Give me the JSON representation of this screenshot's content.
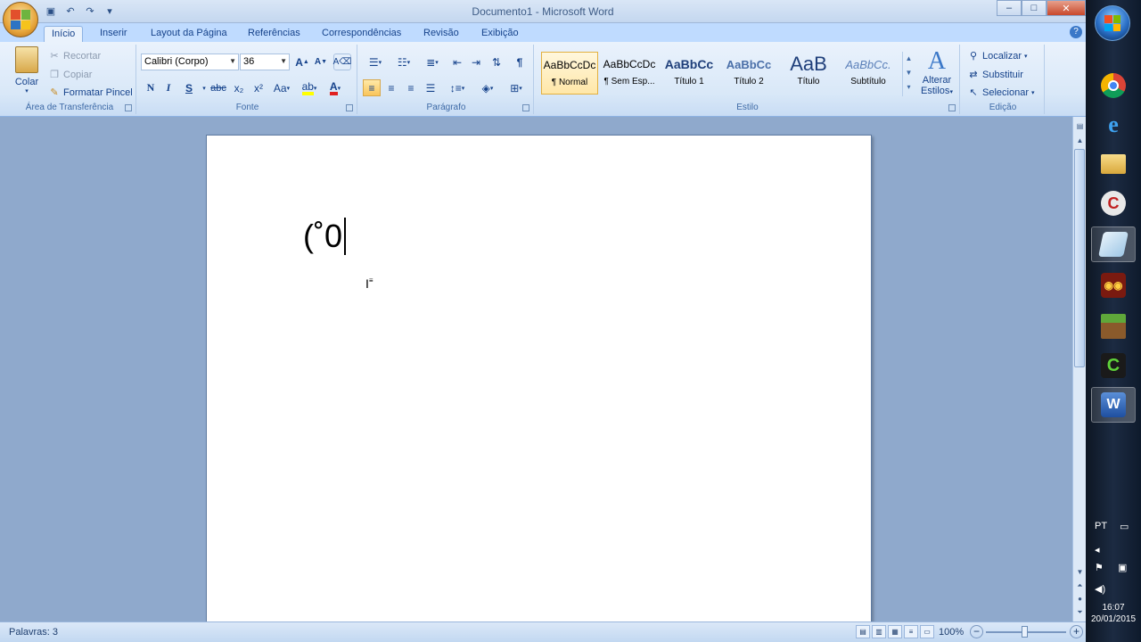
{
  "window": {
    "title": "Documento1 - Microsoft Word",
    "controls": {
      "minimize": "–",
      "maximize": "□",
      "close": "✕"
    }
  },
  "tabs": [
    "Início",
    "Inserir",
    "Layout da Página",
    "Referências",
    "Correspondências",
    "Revisão",
    "Exibição"
  ],
  "active_tab": "Início",
  "ribbon": {
    "clipboard": {
      "label": "Área de Transferência",
      "paste": "Colar",
      "cut": "Recortar",
      "copy": "Copiar",
      "format_painter": "Formatar Pincel"
    },
    "font": {
      "label": "Fonte",
      "font_name": "Calibri (Corpo)",
      "font_size": "36",
      "bold": "N",
      "italic": "I",
      "underline": "S",
      "strikethrough": "abc",
      "subscript": "x₂",
      "superscript": "x²",
      "change_case": "Aa",
      "grow": "A",
      "shrink": "A",
      "font_color_letter": "A"
    },
    "paragraph": {
      "label": "Parágrafo",
      "pilcrow": "¶"
    },
    "styles": {
      "label": "Estilo",
      "items": [
        {
          "preview": "AaBbCcDc",
          "name": "¶ Normal"
        },
        {
          "preview": "AaBbCcDc",
          "name": "¶ Sem Esp..."
        },
        {
          "preview": "AaBbCc",
          "name": "Título 1"
        },
        {
          "preview": "AaBbCc",
          "name": "Título 2"
        },
        {
          "preview": "AaB",
          "name": "Título"
        },
        {
          "preview": "AaBbCc.",
          "name": "Subtítulo"
        }
      ],
      "change_styles_line1": "Alterar",
      "change_styles_line2": "Estilos",
      "change_styles_icon": "A"
    },
    "editing": {
      "label": "Edição",
      "find": "Localizar",
      "replace": "Substituir",
      "select": "Selecionar"
    }
  },
  "document": {
    "text": "(˚0"
  },
  "statusbar": {
    "words": "Palavras: 3",
    "zoom": "100%"
  },
  "taskbar": {
    "language": "PT",
    "time": "16:07",
    "date": "20/01/2015",
    "apps": [
      "chrome",
      "internet-explorer",
      "file-explorer",
      "ccleaner",
      "notepad",
      "fnaf",
      "minecraft",
      "camtasia",
      "word"
    ]
  },
  "colors": {
    "ribbon_bg": "#d9e8f8",
    "accent_text": "#15428b",
    "document_bg": "#8fa9cc",
    "active_style_border": "#e3b040"
  }
}
